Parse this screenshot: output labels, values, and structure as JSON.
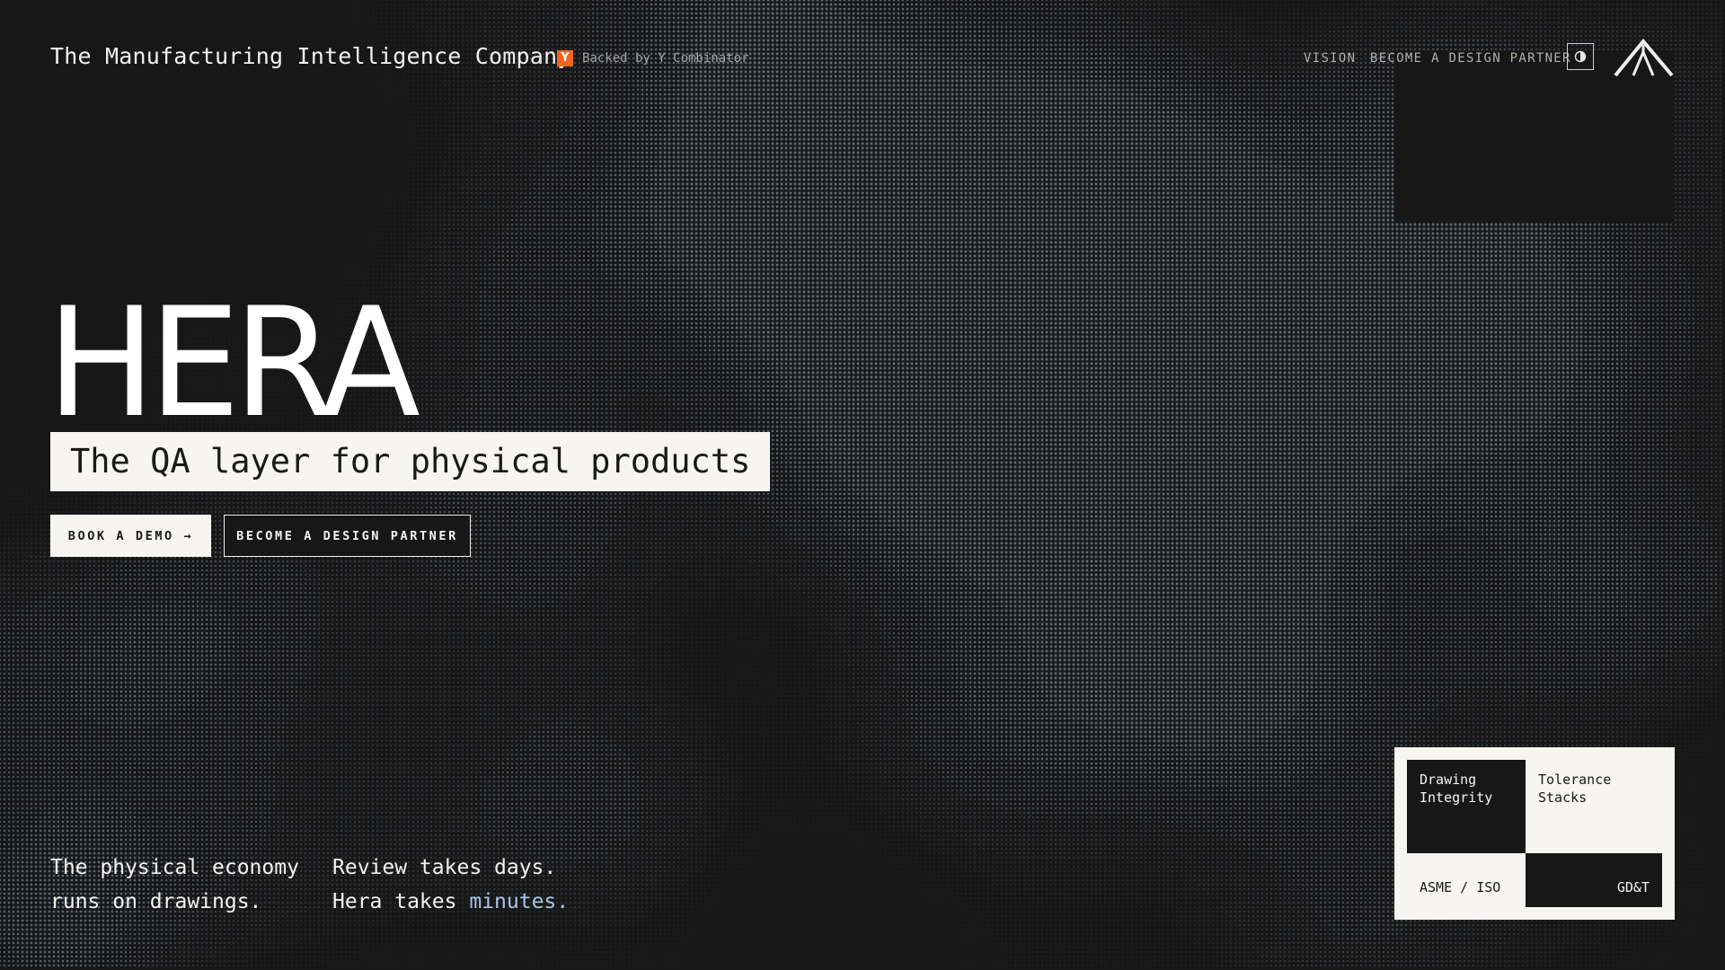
{
  "header": {
    "company_tagline": "The Manufacturing Intelligence Company",
    "backer": {
      "logo_letter": "Y",
      "text": "Backed by Y Combinator",
      "logo_color": "#f26522"
    }
  },
  "nav": {
    "vision": "VISION",
    "design_partner": "BECOME A DESIGN PARTNER",
    "theme_toggle_icon": "contrast-icon",
    "logo_icon": "hera-logo-mark"
  },
  "hero": {
    "title": "HERA",
    "tagline": "The QA layer for physical products",
    "cta_primary": "BOOK A DEMO →",
    "cta_secondary": "BECOME A DESIGN PARTNER"
  },
  "statements": {
    "left_line1": "The physical economy",
    "left_line2": "runs on drawings.",
    "right_line1": "Review takes days.",
    "right_line2_prefix": "Hera takes",
    "right_line2_accent": "minutes."
  },
  "feature_card": {
    "drawing_integrity": "Drawing Integrity",
    "tolerance_stacks": "Tolerance Stacks",
    "asme_iso": "ASME / ISO",
    "gdt": "GD&T"
  },
  "colors": {
    "background": "#171717",
    "foreground": "#f6f5f1",
    "accent": "#a9c5ea",
    "halftone_dot": "#6e7a8c"
  }
}
